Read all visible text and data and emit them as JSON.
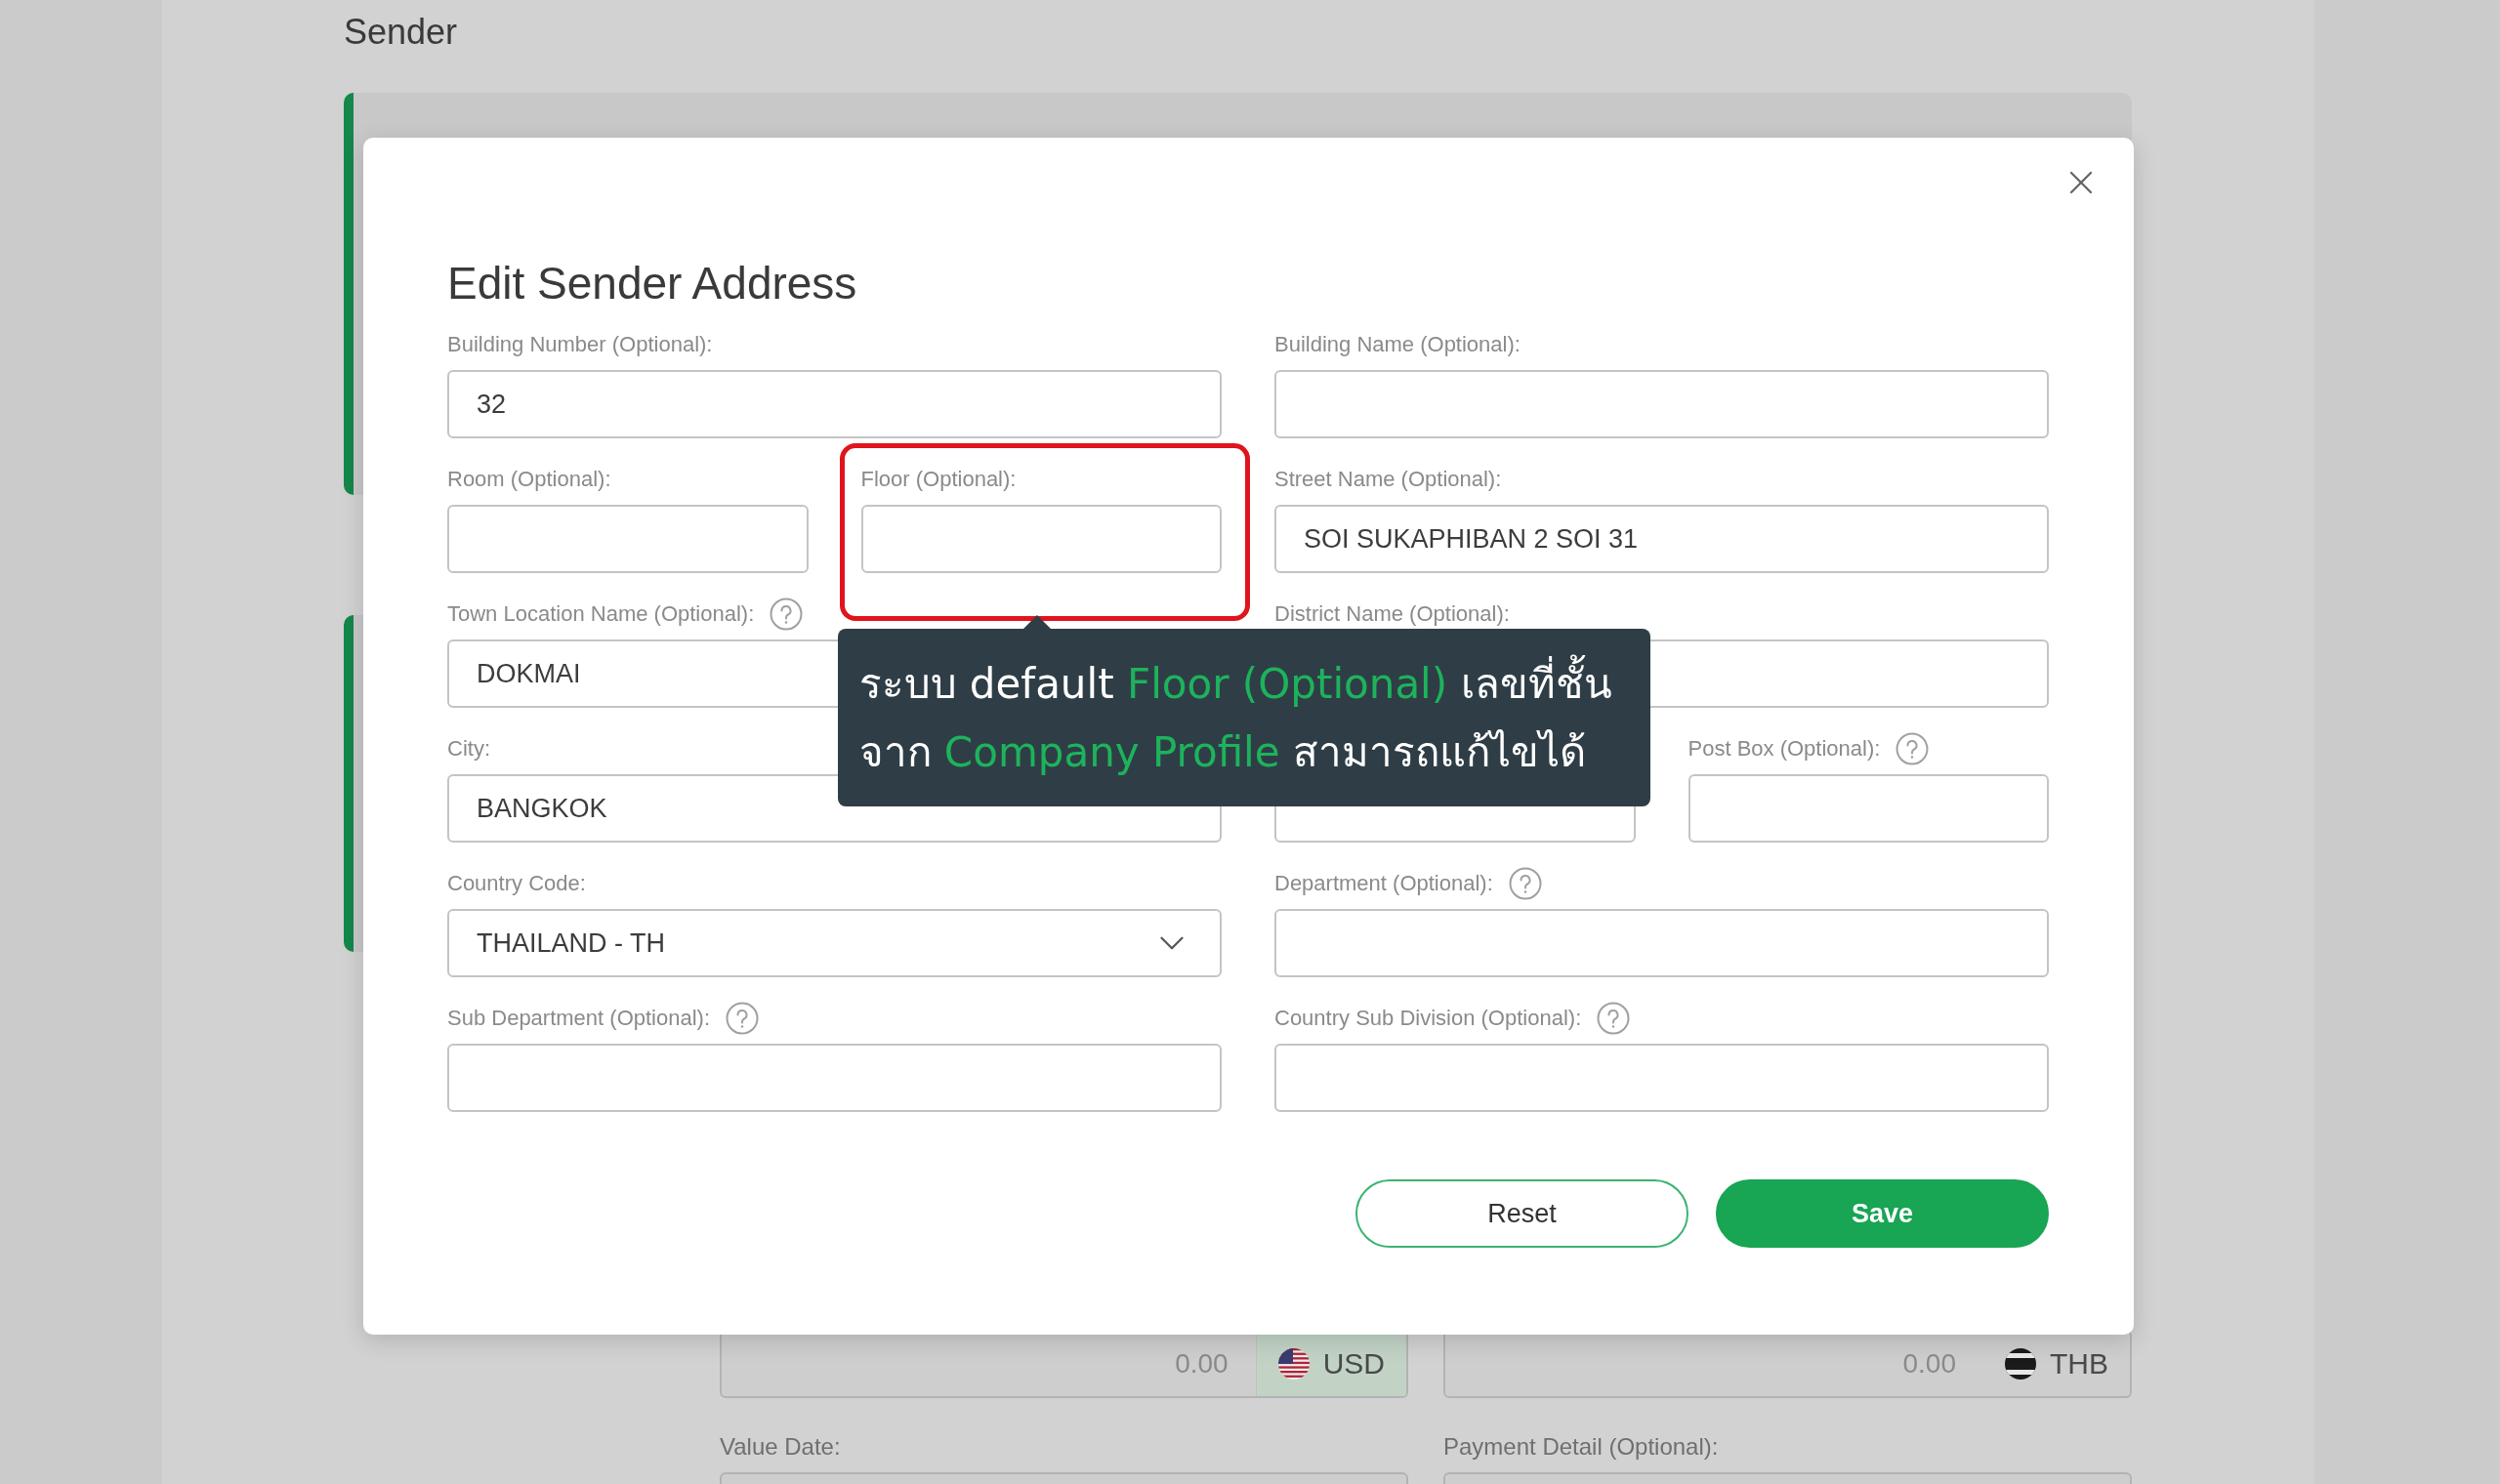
{
  "page": {
    "heading": "Sender",
    "amount_fields": [
      {
        "placeholder": "0.00",
        "currency": "USD",
        "kind": "us",
        "selected": true
      },
      {
        "placeholder": "0.00",
        "currency": "THB",
        "kind": "th",
        "selected": false
      }
    ],
    "labels": [
      "Value Date:",
      "Payment Detail (Optional):"
    ]
  },
  "modal": {
    "title": "Edit Sender Address",
    "fields": [
      {
        "label": "Building Number (Optional):",
        "value": "32"
      },
      {
        "label": "Building Name (Optional):"
      },
      {
        "label": "Room (Optional):"
      },
      {
        "label": "Floor (Optional):",
        "highlighted": true
      },
      {
        "label": "Street Name (Optional):",
        "value": "SOI SUKAPHIBAN 2 SOI 31"
      },
      {
        "label": "Town Location Name (Optional):",
        "value": "DOKMAI",
        "help": true
      },
      {
        "label": "District Name (Optional):"
      },
      {
        "label": "City:",
        "value": "BANGKOK"
      },
      {
        "kind": "input"
      },
      {
        "label": "Post Box (Optional):",
        "help": true
      },
      {
        "label": "Country Code:",
        "value": "THAILAND - TH",
        "kind": "select"
      },
      {
        "label": "Department (Optional):",
        "help": true
      },
      {
        "label": "Sub Department (Optional):",
        "help": true
      },
      {
        "label": "Country Sub Division (Optional):",
        "help": true
      }
    ],
    "buttons": [
      {
        "label": "Reset",
        "kind": "secondary"
      },
      {
        "label": "Save",
        "kind": "primary"
      }
    ]
  },
  "tooltip": {
    "lines": [
      [
        {
          "text": "ระบบ default ",
          "accent": false
        },
        {
          "text": "Floor (Optional)",
          "accent": true
        },
        {
          "text": " เลขที่ชั้น",
          "accent": false
        }
      ],
      [
        {
          "text": "จาก ",
          "accent": false
        },
        {
          "text": "Company Profile",
          "accent": true
        },
        {
          "text": " สามารถแก้ไขได้",
          "accent": false
        }
      ]
    ]
  }
}
